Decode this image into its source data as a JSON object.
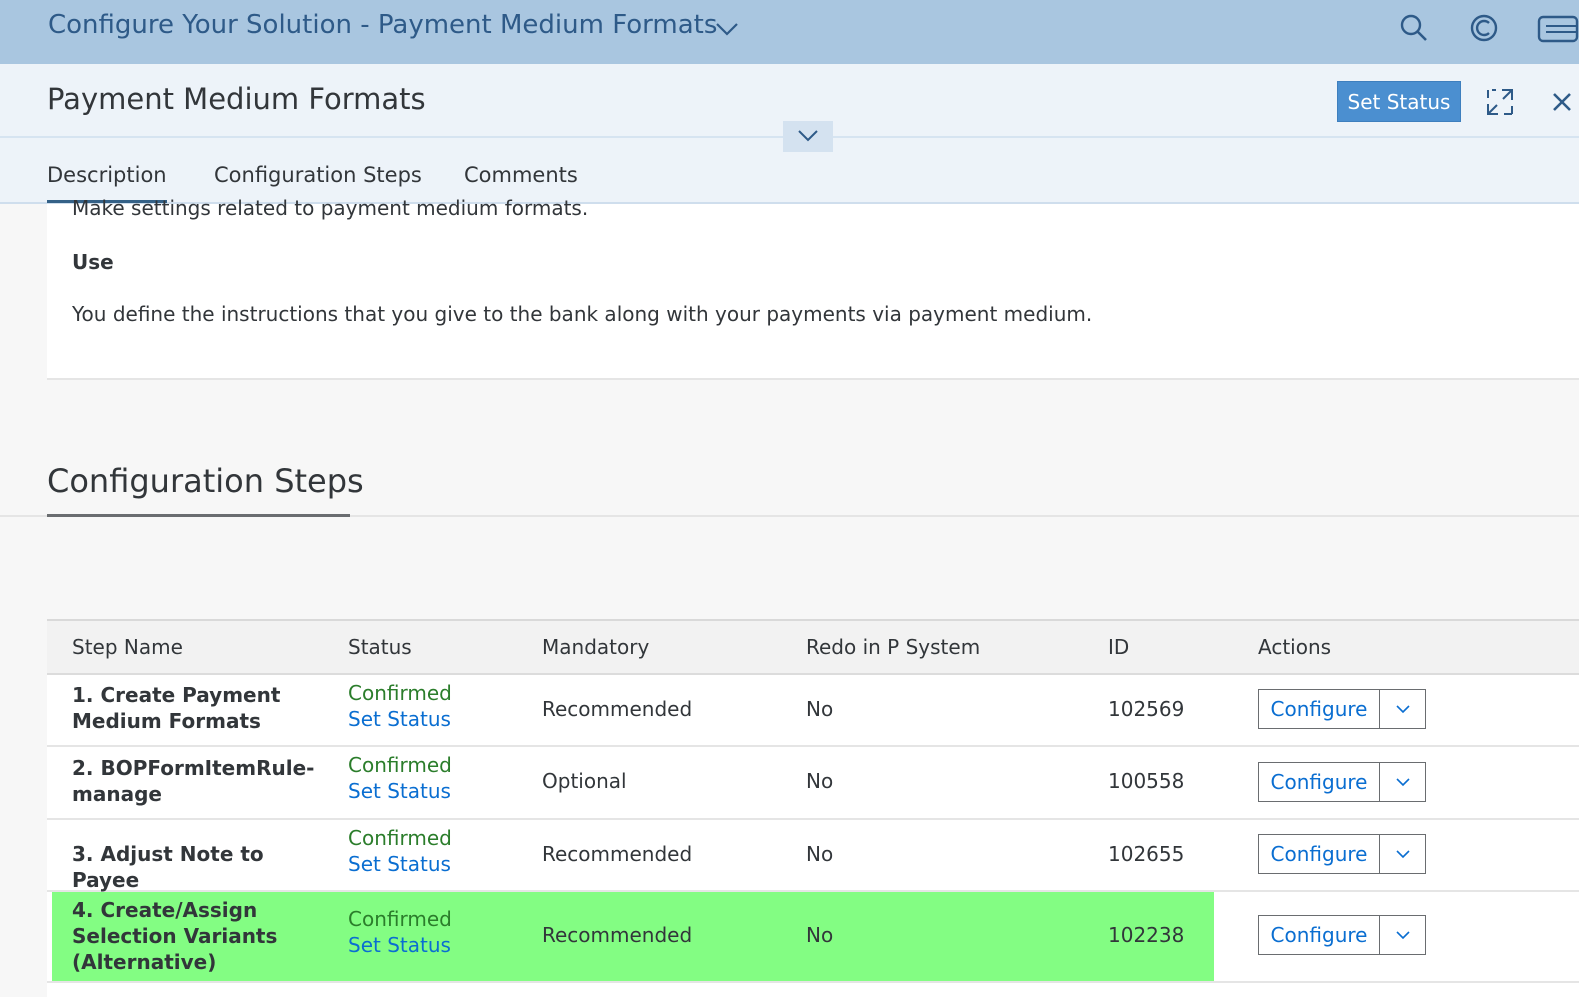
{
  "shell": {
    "title": "Configure Your Solution - Payment Medium Formats"
  },
  "header": {
    "title": "Payment Medium Formats",
    "set_status_label": "Set Status"
  },
  "tabs": [
    {
      "label": "Description"
    },
    {
      "label": "Configuration Steps"
    },
    {
      "label": "Comments"
    }
  ],
  "description": {
    "cut_text": "Make settings related to payment medium formats.",
    "use_heading": "Use",
    "use_text": "You define the instructions that you give to the bank along with your payments via payment medium."
  },
  "config": {
    "title": "Configuration Steps",
    "columns": [
      "Step Name",
      "Status",
      "Mandatory",
      "Redo in P System",
      "ID",
      "Actions"
    ],
    "rows": [
      {
        "step": "1. Create Payment Medium Formats",
        "status": "Confirmed",
        "status_link": "Set Status",
        "mandatory": "Recommended",
        "redo": "No",
        "id": "102569",
        "action": "Configure"
      },
      {
        "step": "2. BOPFormItemRule-manage",
        "status": "Confirmed",
        "status_link": "Set Status",
        "mandatory": "Optional",
        "redo": "No",
        "id": "100558",
        "action": "Configure"
      },
      {
        "step": "3. Adjust Note to Payee",
        "status": "Confirmed",
        "status_link": "Set Status",
        "mandatory": "Recommended",
        "redo": "No",
        "id": "102655",
        "action": "Configure"
      },
      {
        "step": "4. Create/Assign Selection Variants (Alternative)",
        "status": "Confirmed",
        "status_link": "Set Status",
        "mandatory": "Recommended",
        "redo": "No",
        "id": "102238",
        "action": "Configure",
        "highlight_color": "#83fd83"
      }
    ]
  },
  "icons": [
    "chevron-down-icon",
    "search-icon",
    "copilot-icon",
    "notifications-icon",
    "expand-icon",
    "close-icon"
  ]
}
